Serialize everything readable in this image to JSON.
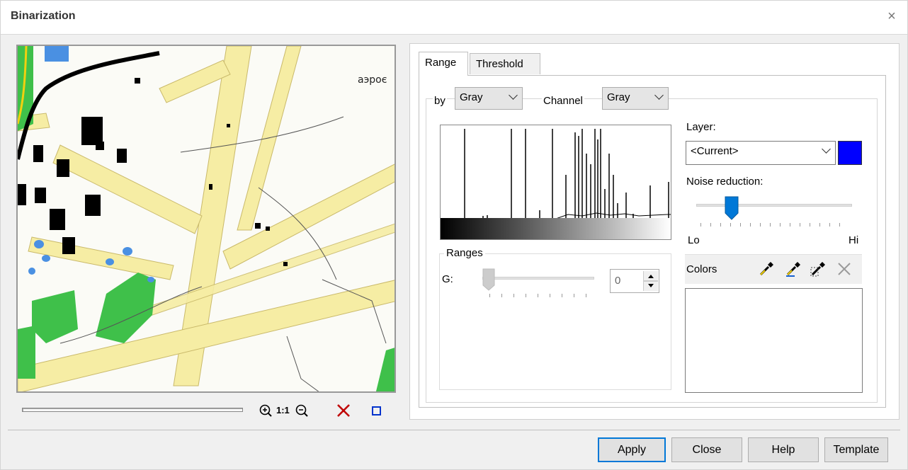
{
  "window": {
    "title": "Binarization",
    "close_glyph": "×"
  },
  "preview": {
    "map_label": "аэроє"
  },
  "preview_toolbar": {
    "zoom_in_icon": "zoom-in-icon",
    "actual_size_label": "1:1",
    "zoom_out_icon": "zoom-out-icon",
    "clear_icon": "delete-x-icon",
    "frame_icon": "select-frame-icon"
  },
  "tabs": [
    {
      "label": "Range",
      "active": true
    },
    {
      "label": "Threshold",
      "active": false
    }
  ],
  "range": {
    "by_label": "by",
    "by_value": "Gray",
    "channel_label": "Channel",
    "channel_value": "Gray",
    "ranges_title": "Ranges",
    "g_label": "G:",
    "g_value": "0"
  },
  "layer": {
    "label": "Layer:",
    "value": "<Current>",
    "color": "#0000ff"
  },
  "noise": {
    "label": "Noise reduction:",
    "lo": "Lo",
    "hi": "Hi",
    "level_fraction": 0.23
  },
  "colors": {
    "label": "Colors",
    "tools": [
      "eyedropper-icon",
      "eyedropper-add-icon",
      "eyedropper-remove-icon",
      "clear-icon"
    ]
  },
  "buttons": {
    "apply": "Apply",
    "close": "Close",
    "help": "Help",
    "template": "Template"
  },
  "colors_palette": {
    "accent": "#0078d7",
    "map_yellow": "#f6eda4",
    "map_green": "#3fc04a",
    "map_blue": "#4a90e2",
    "delete_red": "#c00000"
  }
}
